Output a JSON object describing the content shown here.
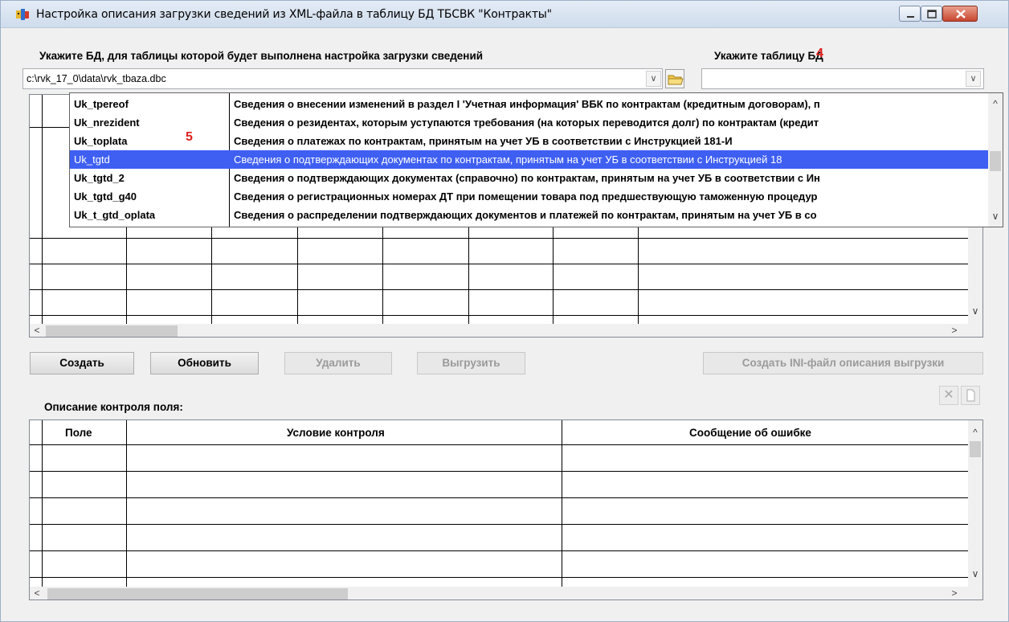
{
  "window": {
    "title": "Настройка описания загрузки сведений из XML-файла в таблицу БД ТБСВК \"Контракты\""
  },
  "db": {
    "label": "Укажите БД, для таблицы которой будет выполнена настройка загрузки сведений",
    "value": "c:\\rvk_17_0\\data\\rvk_tbaza.dbc"
  },
  "table": {
    "label": "Укажите таблицу БД",
    "value": ""
  },
  "annotations": {
    "four": "4",
    "five": "5"
  },
  "dropdown_list": {
    "items": [
      {
        "code": "Uk_tpereof",
        "desc": "Сведения о внесении изменений в раздел I 'Учетная информация' ВБК по контрактам (кредитным договорам), п"
      },
      {
        "code": "Uk_nrezident",
        "desc": "Сведения о резидентах, которым уступаются требования (на которых переводится долг) по контрактам (кредит"
      },
      {
        "code": "Uk_toplata",
        "desc": "Сведения о платежах по контрактам, принятым на учет УБ в соответствии с Инструкцией 181-И"
      },
      {
        "code": "Uk_tgtd",
        "desc": "Сведения о подтверждающих документах по контрактам, принятым на учет УБ в соответствии с Инструкцией 18"
      },
      {
        "code": "Uk_tgtd_2",
        "desc": "Сведения о подтверждающих документах (справочно) по контрактам, принятым на учет УБ в соответствии с Ин"
      },
      {
        "code": "Uk_tgtd_g40",
        "desc": "Сведения о регистрационных номерах ДТ при помещении товара под предшествующую таможенную процедур"
      },
      {
        "code": "Uk_t_gtd_oplata",
        "desc": "Сведения о распределении подтверждающих документов и платежей по контрактам, принятым на учет УБ в со"
      }
    ],
    "selected_index": 3
  },
  "buttons": {
    "create": "Создать",
    "refresh": "Обновить",
    "delete": "Удалить",
    "export": "Выгрузить",
    "create_ini": "Создать INI-файл описания выгрузки"
  },
  "control": {
    "label": "Описание контроля поля:",
    "columns": [
      "Поле",
      "Условие контроля",
      "Сообщение об ошибке"
    ]
  },
  "icons": {
    "scroll_up": "^",
    "scroll_down": "∨",
    "scroll_left": "<",
    "scroll_right": ">",
    "dropdown": "∨",
    "delete_x": "✕"
  },
  "colors": {
    "selection": "#3f5ff2",
    "annotation": "#e0201e"
  }
}
